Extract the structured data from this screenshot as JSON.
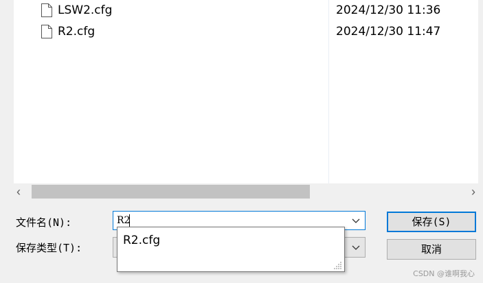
{
  "files": [
    {
      "name": "LSW2.cfg",
      "date": "2024/12/30 11:36",
      "icon": "file-icon"
    },
    {
      "name": "R2.cfg",
      "date": "2024/12/30 11:47",
      "icon": "file-icon"
    }
  ],
  "scrollbar": {
    "left_arrow": "‹",
    "right_arrow": "›"
  },
  "form": {
    "filename_label": "文件名(N):",
    "filename_value": "R2",
    "filetype_label": "保存类型(T):"
  },
  "autocomplete": {
    "items": [
      "R2.cfg"
    ]
  },
  "buttons": {
    "save": "保存(S)",
    "cancel": "取消"
  },
  "watermark": "CSDN @谁啊我心",
  "colors": {
    "accent": "#0078d7",
    "background": "#f0f0f0",
    "list_bg": "#ffffff"
  }
}
